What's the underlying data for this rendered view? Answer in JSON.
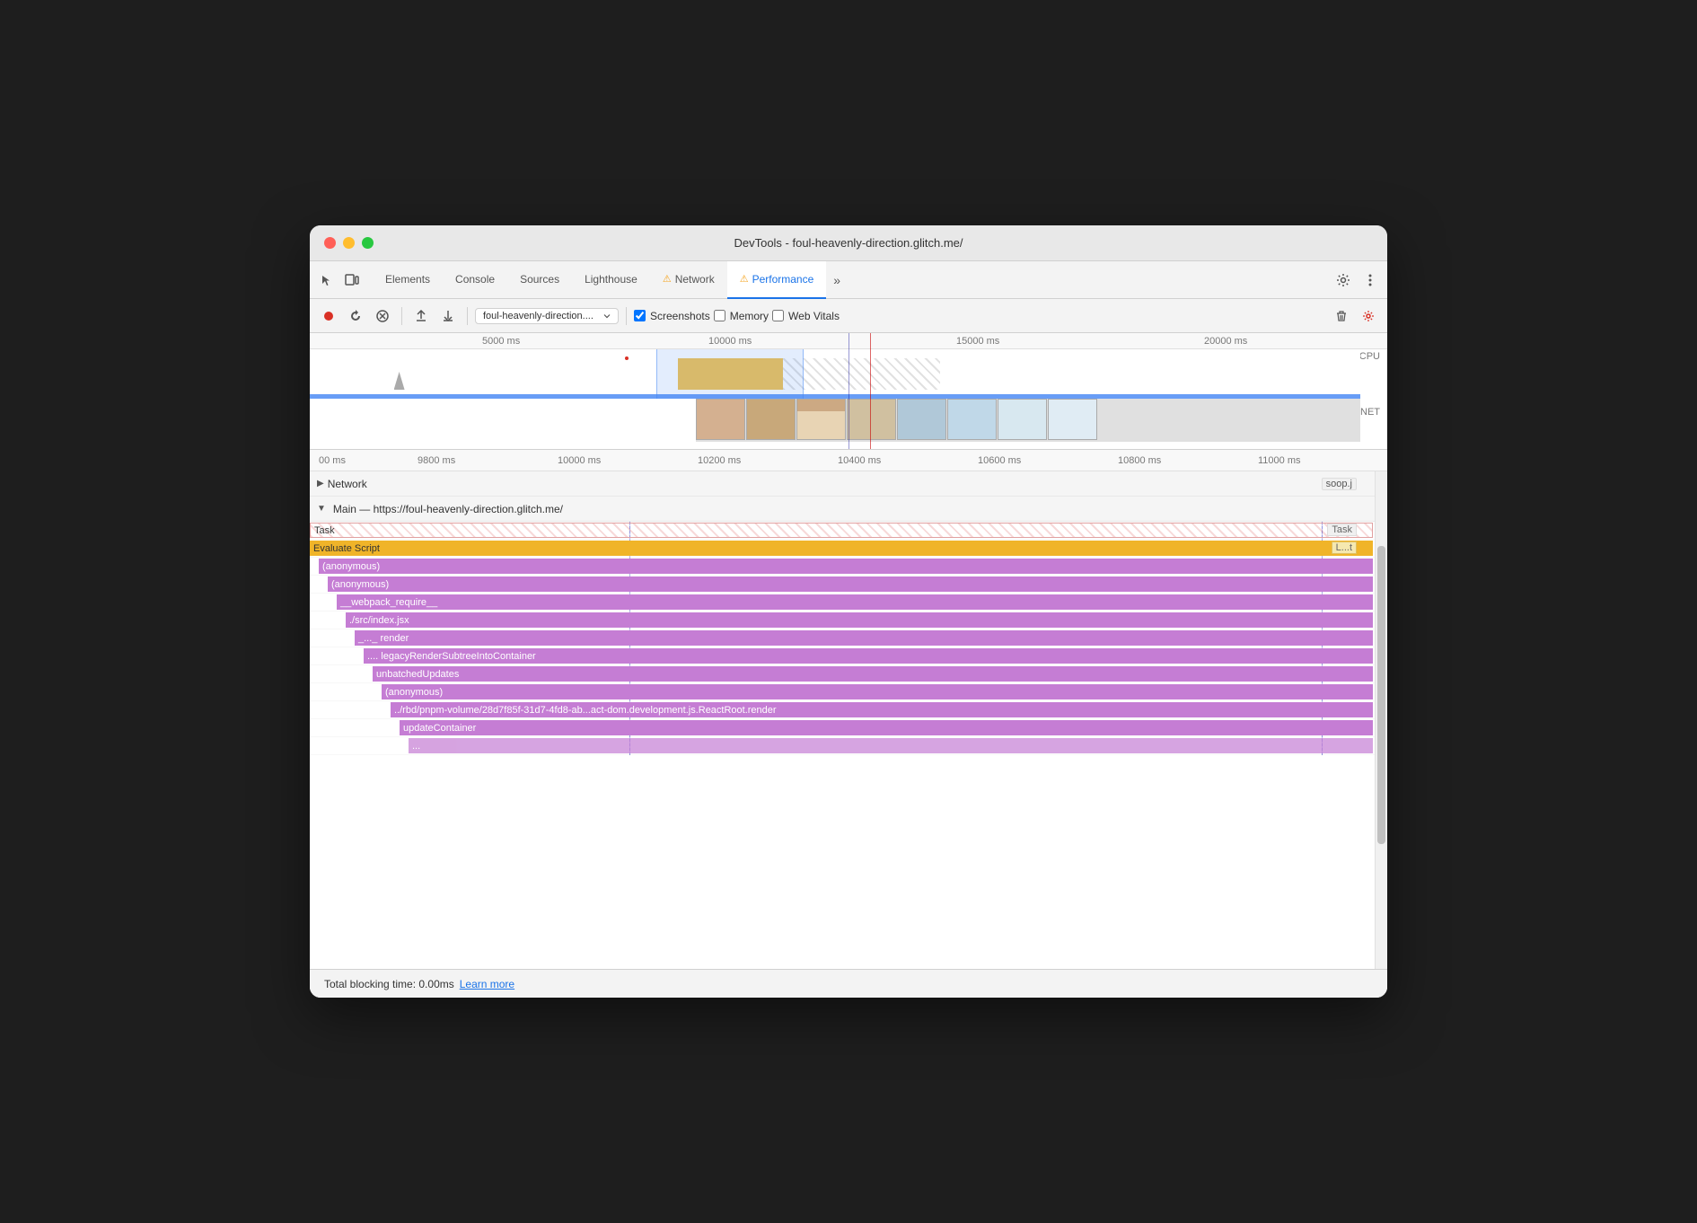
{
  "window": {
    "title": "DevTools - foul-heavenly-direction.glitch.me/"
  },
  "tabs": {
    "items": [
      {
        "label": "Elements",
        "active": false,
        "warn": false
      },
      {
        "label": "Console",
        "active": false,
        "warn": false
      },
      {
        "label": "Sources",
        "active": false,
        "warn": false
      },
      {
        "label": "Lighthouse",
        "active": false,
        "warn": false
      },
      {
        "label": "Network",
        "active": false,
        "warn": true
      },
      {
        "label": "Performance",
        "active": true,
        "warn": true
      }
    ],
    "more_label": "»"
  },
  "toolbar": {
    "url_placeholder": "foul-heavenly-direction....",
    "screenshots_label": "Screenshots",
    "memory_label": "Memory",
    "web_vitals_label": "Web Vitals"
  },
  "timeline": {
    "ruler_marks": [
      "5000 ms",
      "10000 ms",
      "15000 ms",
      "20000 ms"
    ],
    "cpu_label": "CPU",
    "net_label": "NET"
  },
  "detail_ruler": {
    "marks": [
      "00 ms",
      "9800 ms",
      "10000 ms",
      "10200 ms",
      "10400 ms",
      "10600 ms",
      "10800 ms",
      "11000 ms"
    ]
  },
  "network_section": {
    "label": "Network",
    "file_label": "soop.j"
  },
  "main_thread": {
    "header": "Main — https://foul-heavenly-direction.glitch.me/",
    "rows": [
      {
        "label": "Task",
        "right_label": "Task",
        "type": "task",
        "indent": 0
      },
      {
        "label": "Evaluate Script",
        "right_label": "L...t",
        "type": "evaluate",
        "indent": 0
      },
      {
        "label": "(anonymous)",
        "right_label": "",
        "type": "anon",
        "indent": 1
      },
      {
        "label": "(anonymous)",
        "right_label": "",
        "type": "anon",
        "indent": 2
      },
      {
        "label": "__webpack_require__",
        "right_label": "",
        "type": "webpack",
        "indent": 3
      },
      {
        "label": "./src/index.jsx",
        "right_label": "",
        "type": "src",
        "indent": 4
      },
      {
        "label": "_..._ render",
        "right_label": "",
        "type": "render",
        "indent": 5
      },
      {
        "label": ".... legacyRenderSubtreeIntoContainer",
        "right_label": "",
        "type": "legacy",
        "indent": 6
      },
      {
        "label": "unbatchedUpdates",
        "right_label": "",
        "type": "unbatched",
        "indent": 7
      },
      {
        "label": "(anonymous)",
        "right_label": "",
        "type": "anon",
        "indent": 8
      },
      {
        "label": "../rbd/pnpm-volume/28d7f85f-31d7-4fd8-ab...act-dom.development.js.ReactRoot.render",
        "right_label": "",
        "type": "rbd",
        "indent": 9
      },
      {
        "label": "updateContainer",
        "right_label": "",
        "type": "update",
        "indent": 10
      },
      {
        "label": "...",
        "right_label": "",
        "type": "anon",
        "indent": 11
      }
    ]
  },
  "status_bar": {
    "text": "Total blocking time: 0.00ms",
    "learn_more": "Learn more"
  }
}
